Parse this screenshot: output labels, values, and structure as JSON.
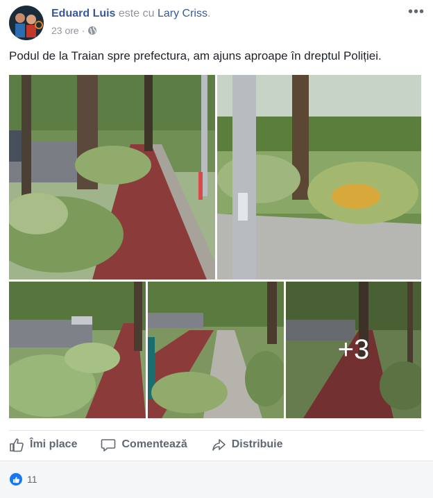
{
  "post": {
    "author": "Eduard Luis",
    "with_text": "este cu",
    "tagged": "Lary Criss",
    "time": "23 ore",
    "text": "Podul de la Traian spre prefectura, am ajuns aproape în dreptul Poliției.",
    "more_photos": "+3"
  },
  "actions": {
    "like": "Îmi place",
    "comment": "Comentează",
    "share": "Distribuie"
  },
  "reactions": {
    "count": "11"
  },
  "icons": {
    "options": "more-options-icon",
    "privacy": "globe-icon",
    "like": "thumbs-up-icon",
    "comment": "comment-bubble-icon",
    "share": "share-arrow-icon"
  },
  "colors": {
    "link": "#385898",
    "meta": "#90949c",
    "action": "#606770",
    "like_badge": "#1877f2"
  }
}
